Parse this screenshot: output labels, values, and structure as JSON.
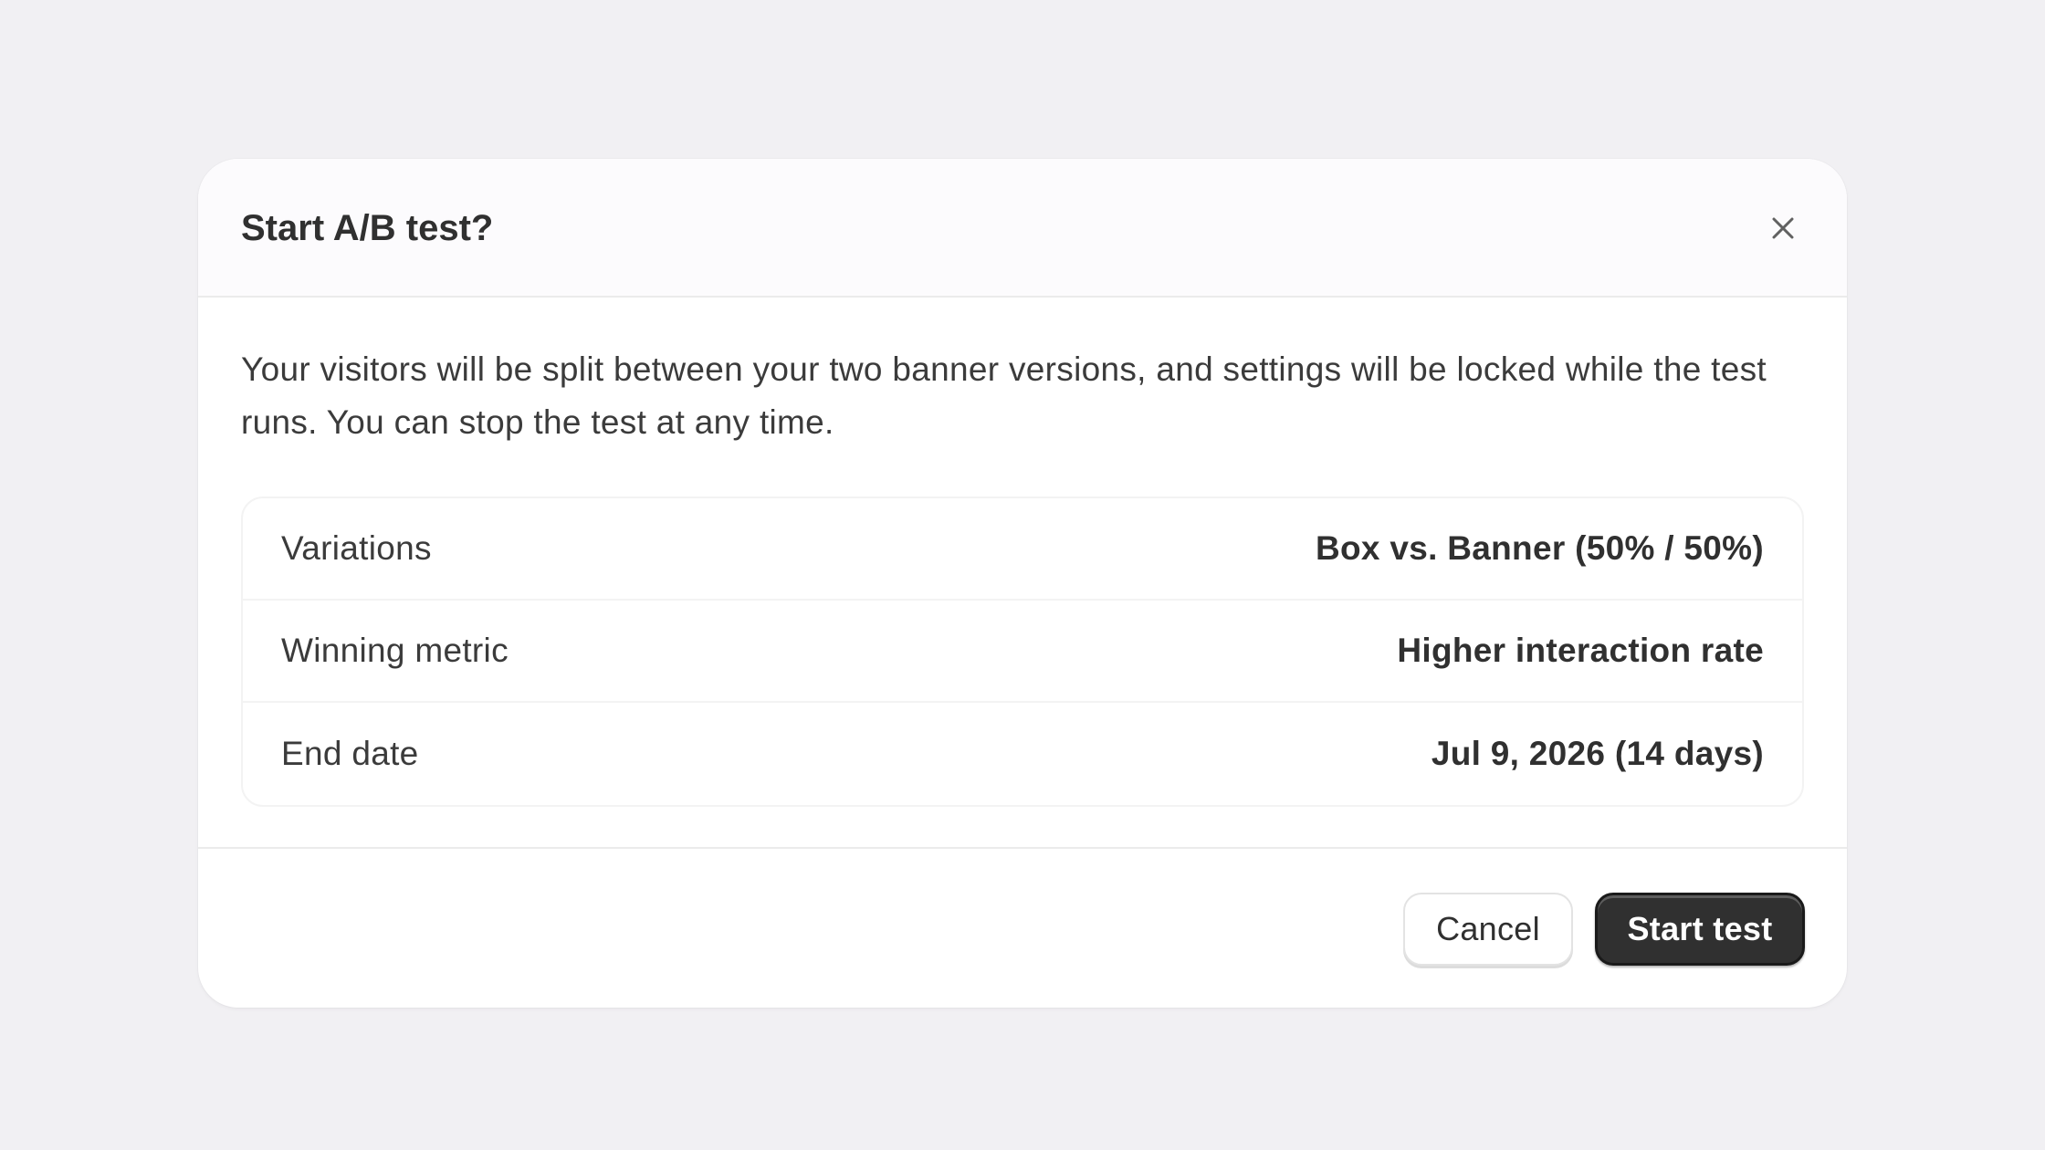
{
  "dialog": {
    "title": "Start A/B test?",
    "close_icon": "close-icon",
    "description": "Your visitors will be split between your two banner versions, and settings will be locked while the test runs. You can stop the test at any time.",
    "summary": [
      {
        "label": "Variations",
        "value": "Box vs. Banner (50% / 50%)"
      },
      {
        "label": "Winning metric",
        "value": "Higher interaction rate"
      },
      {
        "label": "End date",
        "value": "Jul 9, 2026 (14 days)"
      }
    ],
    "cancel_label": "Cancel",
    "start_label": "Start test"
  },
  "colors": {
    "background": "#f1f0f3",
    "primary_button": "#303030",
    "text": "#303030"
  }
}
